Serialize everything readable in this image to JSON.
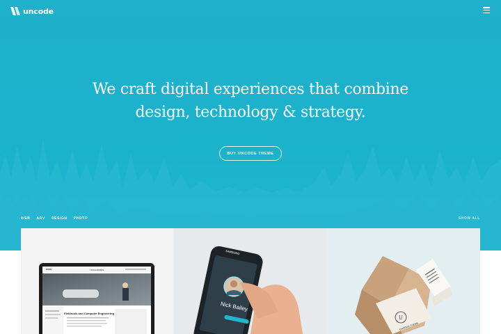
{
  "app": {
    "logo_text": "uncode",
    "logo_icon": "uncode-logo-icon",
    "menu_icon": "hamburger-menu-icon"
  },
  "hero": {
    "headline_line1": "We craft digital experiences that combine",
    "headline_line2": "design, technology & strategy.",
    "cta_label": "BUY UNCODE THEME",
    "bg_color": "#1fb0cb"
  },
  "portfolio": {
    "filters": [
      "WEB",
      "ADV",
      "DESIGN",
      "PHOTO"
    ],
    "show_all": "SHOW ALL",
    "items": [
      {
        "category": "web",
        "screen_brand": "TRICHORMES",
        "screen_heading": "Elektronik and Computer Engineering"
      },
      {
        "category": "adv",
        "phone_brand": "SAMSUNG",
        "contact_name": "Nick Bailey"
      },
      {
        "category": "design",
        "card_text": "UNCODE THEME"
      }
    ]
  }
}
